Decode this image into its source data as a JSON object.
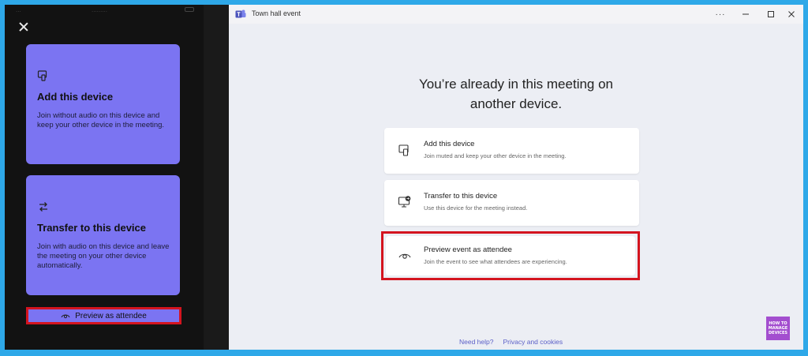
{
  "mobile": {
    "status": {
      "left": "...",
      "center": ".........",
      "right": ""
    },
    "card_add": {
      "title": "Add this device",
      "description": "Join without audio on this device and keep your other device in the meeting.",
      "icon": "device-add-icon"
    },
    "card_transfer": {
      "title": "Transfer to this device",
      "description": "Join with audio on this device and leave the meeting on your other device automatically.",
      "icon": "transfer-arrows-icon"
    },
    "preview_button": {
      "label": "Preview as attendee",
      "icon": "eye-icon"
    }
  },
  "window": {
    "title": "Town hall event",
    "more_label": "···",
    "heading_line1": "You’re already in this meeting on",
    "heading_line2": "another device.",
    "options": [
      {
        "title": "Add this device",
        "description": "Join muted and keep your other device in the meeting.",
        "icon": "device-add-icon"
      },
      {
        "title": "Transfer to this device",
        "description": "Use this device for the meeting instead.",
        "icon": "monitor-transfer-icon"
      },
      {
        "title": "Preview event as attendee",
        "description": "Join the event to see what attendees are experiencing.",
        "icon": "eye-icon"
      }
    ],
    "footer": {
      "help": "Need help?",
      "privacy": "Privacy and cookies"
    }
  },
  "badge": {
    "line1": "HOW TO",
    "line2": "MANAGE",
    "line3": "DEVICES"
  },
  "colors": {
    "mobile_card": "#7b74f2",
    "highlight": "#d4141f",
    "link": "#5b5fc7",
    "frame": "#2ea8e8"
  }
}
